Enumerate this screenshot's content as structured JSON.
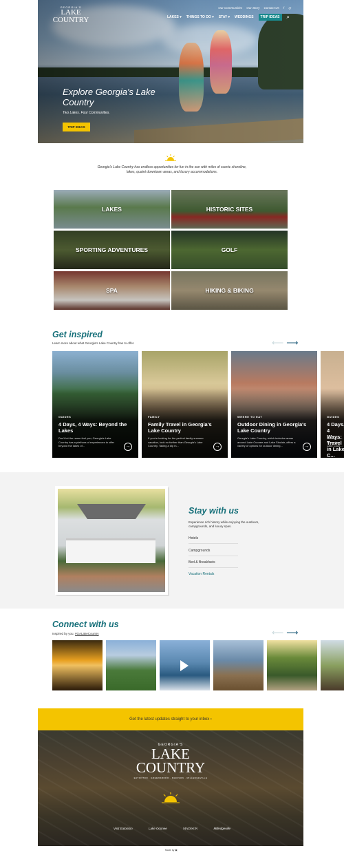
{
  "header": {
    "logo": {
      "top": "GEORGIA'S",
      "main": "LAKE COUNTRY"
    },
    "top_links": [
      "Our Communities",
      "Our Story",
      "Contact Us"
    ],
    "social_icons": [
      "facebook-icon",
      "instagram-icon"
    ],
    "nav": [
      {
        "label": "LAKES ▾"
      },
      {
        "label": "THINGS TO DO ▾"
      },
      {
        "label": "STAY ▾"
      },
      {
        "label": "WEDDINGS"
      }
    ],
    "trip_button": "TRIP IDEAS",
    "search_icon": "search-icon"
  },
  "hero": {
    "title": "Explore Georgia's Lake Country",
    "subtitle": "Two Lakes. Four Communities.",
    "button": "TRIP IDEAS"
  },
  "intro": {
    "text": "Georgia's Lake Country has endless opportunities for fun in the sun with miles of scenic shoreline, lakes, quaint downtown areas, and luxury accommodations."
  },
  "categories": [
    {
      "label": "LAKES"
    },
    {
      "label": "HISTORIC SITES"
    },
    {
      "label": "SPORTING ADVENTURES"
    },
    {
      "label": "GOLF"
    },
    {
      "label": "SPA"
    },
    {
      "label": "HIKING & BIKING"
    }
  ],
  "inspired": {
    "title": "Get inspired",
    "subtitle": "Learn more about what Georgia's Lake Country has to offer.",
    "cards": [
      {
        "tag": "GUIDES",
        "title": "4 Days, 4 Ways: Beyond the Lakes",
        "desc": "Don't let the name fool you; Georgia's Lake Country has a plethora of experiences to offer beyond the lakes of..."
      },
      {
        "tag": "FAMILY",
        "title": "Family Travel in Georgia's Lake Country",
        "desc": "If you're looking for the perfect family summer vacation, look no further than Georgia's Lake Country. Taking a dip in..."
      },
      {
        "tag": "WHERE TO EAT",
        "title": "Outdoor Dining in Georgia's Lake Country",
        "desc": "Georgia's Lake Country, which includes areas around Lake Oconee and Lake Sinclair, offers a variety of options for outdoor dining..."
      },
      {
        "tag": "GUIDES",
        "title": "4 Days, 4 Ways: Travel in Lake C...",
        "desc": "Looking for... down, the... Lake Coun..."
      }
    ]
  },
  "stay": {
    "title": "Stay with us",
    "desc": "Experience rich history while enjoying the outdoors, campgrounds, and luxury spas.",
    "links": [
      "Hotels",
      "Campgrounds",
      "Bed & Breakfasts",
      "Vacation Rentals"
    ]
  },
  "connect": {
    "title": "Connect with us",
    "subtitle_prefix": "Inspired by you. ",
    "hashtag": "#GALakeCountry"
  },
  "newsletter": {
    "text": "Get the latest updates straight to your inbox ›"
  },
  "footer": {
    "logo_top": "GEORGIA'S",
    "logo_main": "LAKE COUNTRY",
    "logo_sub": "EATONTON · GREENSBORO · MADISON · MILLEDGEVILLE",
    "partners": [
      "Visit Eatonton",
      "Lake Oconee",
      "MADISON",
      "Milledgeville"
    ],
    "made_by": "Made by"
  },
  "colors": {
    "teal": "#17707a",
    "yellow": "#f4c400",
    "nav_teal": "#1a8a8e"
  }
}
